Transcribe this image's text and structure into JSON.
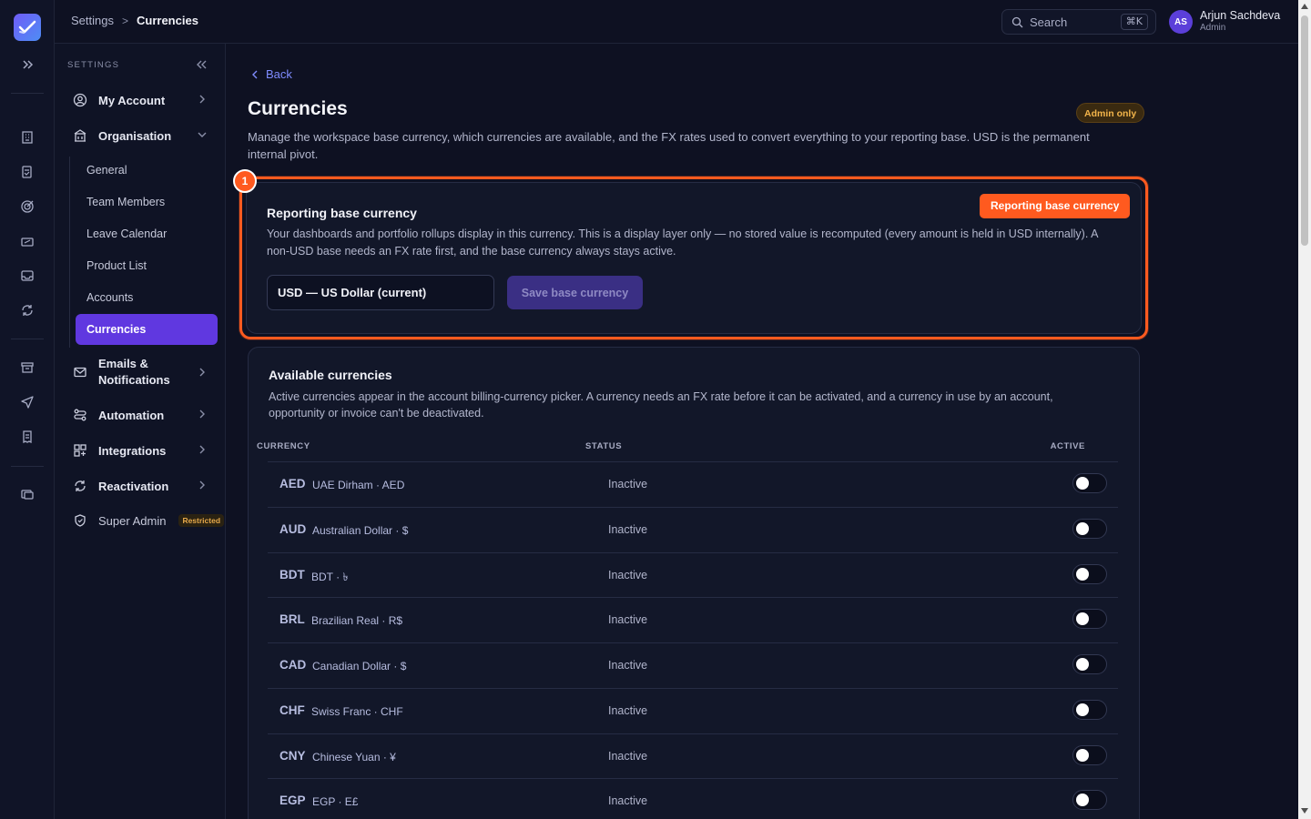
{
  "topbar": {
    "breadcrumb_root": "Settings",
    "breadcrumb_sep": ">",
    "breadcrumb_current": "Currencies",
    "search_label": "Search",
    "search_shortcut": "⌘K",
    "user_initials": "AS",
    "user_name": "Arjun Sachdeva",
    "user_role": "Admin"
  },
  "sidebar": {
    "title": "SETTINGS",
    "items": [
      {
        "label": "My Account",
        "icon": "user-circle-icon"
      },
      {
        "label": "Organisation",
        "icon": "building-icon"
      },
      {
        "label": "Emails & Notifications",
        "icon": "mail-icon"
      },
      {
        "label": "Automation",
        "icon": "automation-icon"
      },
      {
        "label": "Integrations",
        "icon": "grid-icon"
      },
      {
        "label": "Reactivation",
        "icon": "refresh-icon"
      },
      {
        "label": "Super Admin",
        "icon": "shield-icon"
      }
    ],
    "sub_items": [
      "General",
      "Team Members",
      "Leave Calendar",
      "Product List",
      "Accounts",
      "Currencies"
    ],
    "emails_line1": "Emails &",
    "emails_line2": "Notifications",
    "restricted_badge": "Restricted"
  },
  "page": {
    "back_label": "Back",
    "title": "Currencies",
    "admin_badge": "Admin only",
    "description": "Manage the workspace base currency, which currencies are available, and the FX rates used to convert everything to your reporting base. USD is the permanent internal pivot."
  },
  "base_currency": {
    "highlight_number": "1",
    "highlight_tag": "Reporting base currency",
    "title": "Reporting base currency",
    "description": "Your dashboards and portfolio rollups display in this currency. This is a display layer only — no stored value is recomputed (every amount is held in USD internally). A non-USD base needs an FX rate first, and the base currency always stays active.",
    "selected": "USD — US Dollar (current)",
    "save_label": "Save base currency"
  },
  "available": {
    "title": "Available currencies",
    "description": "Active currencies appear in the account billing-currency picker. A currency needs an FX rate before it can be activated, and a currency in use by an account, opportunity or invoice can't be deactivated.",
    "col_currency": "CURRENCY",
    "col_status": "STATUS",
    "col_active": "ACTIVE",
    "rows": [
      {
        "code": "AED",
        "name": "UAE Dirham · AED",
        "status": "Inactive",
        "active": false
      },
      {
        "code": "AUD",
        "name": "Australian Dollar · $",
        "status": "Inactive",
        "active": false
      },
      {
        "code": "BDT",
        "name": "BDT · ৳",
        "status": "Inactive",
        "active": false
      },
      {
        "code": "BRL",
        "name": "Brazilian Real · R$",
        "status": "Inactive",
        "active": false
      },
      {
        "code": "CAD",
        "name": "Canadian Dollar · $",
        "status": "Inactive",
        "active": false
      },
      {
        "code": "CHF",
        "name": "Swiss Franc · CHF",
        "status": "Inactive",
        "active": false
      },
      {
        "code": "CNY",
        "name": "Chinese Yuan · ¥",
        "status": "Inactive",
        "active": false
      },
      {
        "code": "EGP",
        "name": "EGP · E£",
        "status": "Inactive",
        "active": false
      }
    ]
  },
  "colors": {
    "accent": "#6038e0",
    "highlight": "#ff5a1f",
    "link": "#7f8cff",
    "background": "#0e1122"
  }
}
